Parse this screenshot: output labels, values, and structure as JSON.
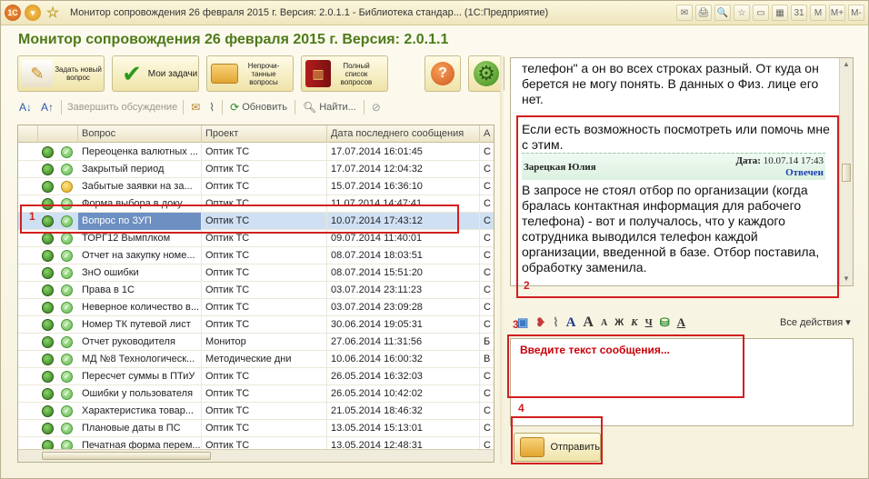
{
  "window": {
    "title": "Монитор сопровождения 26 февраля 2015 г. Версия: 2.0.1.1 - Библиотека стандар... (1С:Предприятие)",
    "logo_label": "1C",
    "right_tools": [
      "✉",
      "🖨",
      "🔍",
      "☆",
      "▭",
      "▦",
      "31",
      "M",
      "M+",
      "M-"
    ]
  },
  "form": {
    "title": "Монитор сопровождения 26 февраля 2015 г. Версия: 2.0.1.1"
  },
  "big_buttons": [
    {
      "label": "Задать новый вопрос",
      "icon": "ask-question-icon"
    },
    {
      "label": "Мои задачи",
      "icon": "checkmark-icon"
    },
    {
      "label": "Непрочи-танные вопросы",
      "icon": "unread-envelope-icon"
    },
    {
      "label": "Полный список вопросов",
      "icon": "books-icon"
    }
  ],
  "toolbar": {
    "finish_label": "Завершить обсуждение",
    "refresh_label": "Обновить",
    "find_label": "Найти..."
  },
  "grid": {
    "columns": [
      "Вопрос",
      "Проект",
      "Дата последнего сообщения",
      "А"
    ],
    "rows": [
      {
        "q": "Переоценка валютных ...",
        "p": "Оптик ТС",
        "d": "17.07.2014 16:01:45",
        "a": "С",
        "st": "ok"
      },
      {
        "q": "Закрытый период",
        "p": "Оптик ТС",
        "d": "17.07.2014 12:04:32",
        "a": "С",
        "st": "ok"
      },
      {
        "q": "Забытые заявки на за...",
        "p": "Оптик ТС",
        "d": "15.07.2014 16:36:10",
        "a": "С",
        "st": "wait"
      },
      {
        "q": "Форма выбора в доку...",
        "p": "Оптик ТС",
        "d": "11.07.2014 14:47:41",
        "a": "С",
        "st": "ok"
      },
      {
        "q": "Вопрос по ЗУП",
        "p": "Оптик ТС",
        "d": "10.07.2014 17:43:12",
        "a": "С",
        "st": "ok"
      },
      {
        "q": "ТОРГ12 Вымплком",
        "p": "Оптик ТС",
        "d": "09.07.2014 11:40:01",
        "a": "С",
        "st": "ok"
      },
      {
        "q": "Отчет на закупку номе...",
        "p": "Оптик ТС",
        "d": "08.07.2014 18:03:51",
        "a": "С",
        "st": "ok"
      },
      {
        "q": "ЗнО ошибки",
        "p": "Оптик ТС",
        "d": "08.07.2014 15:51:20",
        "a": "С",
        "st": "ok"
      },
      {
        "q": "Права в 1С",
        "p": "Оптик ТС",
        "d": "03.07.2014 23:11:23",
        "a": "С",
        "st": "ok"
      },
      {
        "q": "Неверное количество в...",
        "p": "Оптик ТС",
        "d": "03.07.2014 23:09:28",
        "a": "С",
        "st": "ok"
      },
      {
        "q": "Номер ТК путевой лист",
        "p": "Оптик ТС",
        "d": "30.06.2014 19:05:31",
        "a": "С",
        "st": "ok"
      },
      {
        "q": "Отчет руководителя",
        "p": "Монитор",
        "d": "27.06.2014 11:31:56",
        "a": "Б",
        "st": "ok"
      },
      {
        "q": "МД №8 Технологическ...",
        "p": "Методические дни",
        "d": "10.06.2014 16:00:32",
        "a": "В",
        "st": "ok"
      },
      {
        "q": "Пересчет суммы в ПТиУ",
        "p": "Оптик ТС",
        "d": "26.05.2014 16:32:03",
        "a": "С",
        "st": "ok"
      },
      {
        "q": "Ошибки у пользователя",
        "p": "Оптик ТС",
        "d": "26.05.2014 10:42:02",
        "a": "С",
        "st": "ok"
      },
      {
        "q": "Характеристика товар...",
        "p": "Оптик ТС",
        "d": "21.05.2014 18:46:32",
        "a": "С",
        "st": "ok"
      },
      {
        "q": "Плановые даты в ПС",
        "p": "Оптик ТС",
        "d": "13.05.2014 15:13:01",
        "a": "С",
        "st": "ok"
      },
      {
        "q": "Печатная форма перем...",
        "p": "Оптик ТС",
        "d": "13.05.2014 12:48:31",
        "a": "С",
        "st": "ok"
      }
    ],
    "selected_index": 4
  },
  "chat": {
    "prev_text": "телефон\" а он во всех строках разный. От куда он берется не могу понять. В данных о Физ. лице его нет.",
    "request_text": "Если есть возможность посмотреть или помочь мне с этим.",
    "author": "Зарецкая Юлия",
    "date_label": "Дата:",
    "date_value": "10.07.14 17:43",
    "status": "Отвечен",
    "reply_text": "В запросе не стоял отбор по организации (когда бралась контактная информация для рабочего телефона) - вот и получалось, что у каждого сотрудника выводился телефон каждой организации, введенной в базе. Отбор поставила, обработку заменила."
  },
  "editor": {
    "tools": [
      "A",
      "A",
      "A",
      "Ж",
      "К",
      "Ч",
      "A"
    ],
    "all_actions": "Все действия ▾",
    "placeholder": "Введите текст сообщения..."
  },
  "send_label": "Отправить",
  "annotations": [
    "1",
    "2",
    "3",
    "4"
  ]
}
